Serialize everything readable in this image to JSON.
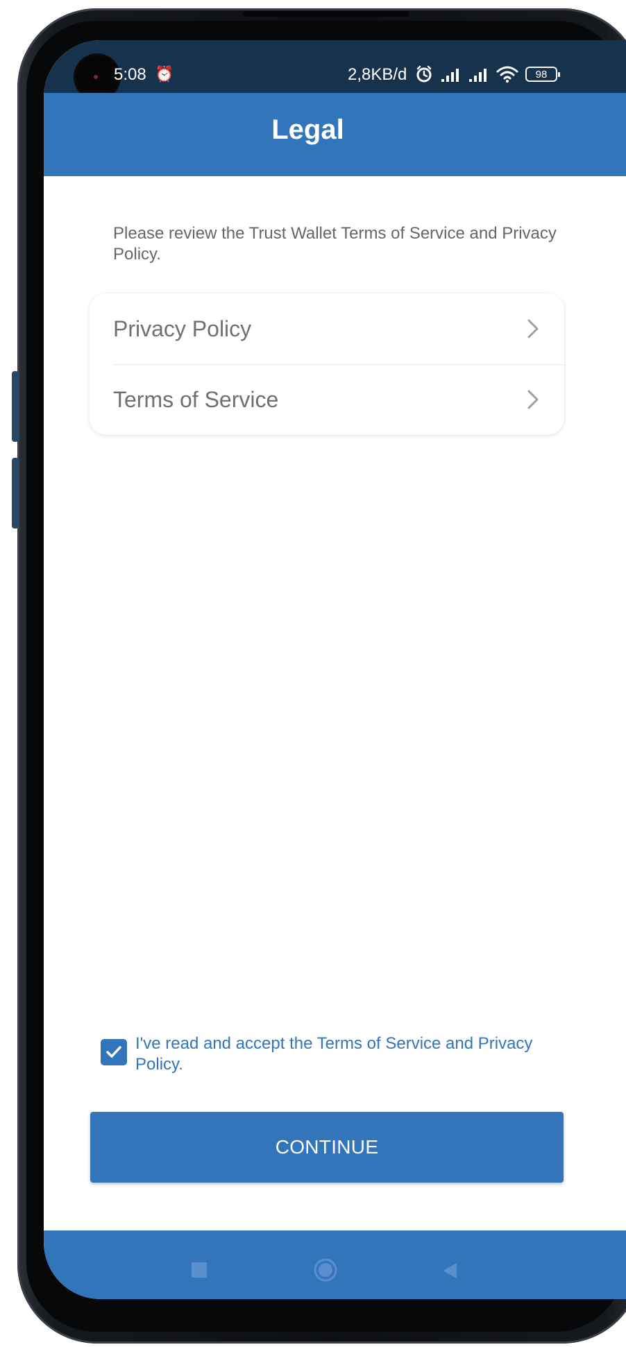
{
  "status_bar": {
    "time": "5:08",
    "network_speed": "2,8KB/d",
    "battery_level": "98",
    "icons": [
      "alarm-icon",
      "signal-icon",
      "signal-icon",
      "wifi-icon",
      "battery-icon"
    ]
  },
  "header": {
    "title": "Legal"
  },
  "intro": {
    "text": "Please review the Trust Wallet Terms of Service and Privacy Policy."
  },
  "links": [
    {
      "label": "Privacy Policy",
      "icon": "chevron-right-icon"
    },
    {
      "label": "Terms of Service",
      "icon": "chevron-right-icon"
    }
  ],
  "acceptance": {
    "checked": true,
    "text": "I've read and accept the Terms of Service and Privacy Policy."
  },
  "continue_button": {
    "label": "CONTINUE"
  },
  "navigation": {
    "icons": [
      "recent-apps-icon",
      "home-icon",
      "back-icon"
    ]
  },
  "colors": {
    "brand_blue": "#3375bb",
    "status_bar": "#17324d",
    "text_secondary": "#666666"
  }
}
